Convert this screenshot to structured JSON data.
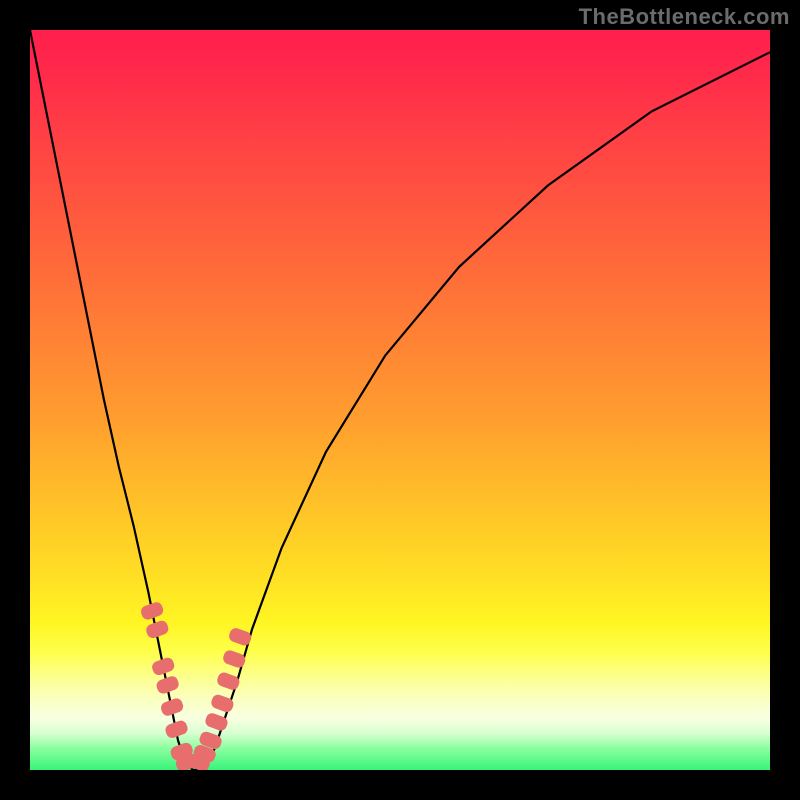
{
  "watermark": {
    "text": "TheBottleneck.com"
  },
  "chart_data": {
    "type": "line",
    "title": "",
    "xlabel": "",
    "ylabel": "",
    "xlim": [
      0,
      100
    ],
    "ylim": [
      0,
      100
    ],
    "grid": false,
    "legend": false,
    "series": [
      {
        "name": "bottleneck-curve",
        "x": [
          0,
          2,
          4,
          6,
          8,
          10,
          12,
          14,
          16,
          18,
          19,
          20,
          21,
          22,
          23,
          24,
          25,
          26,
          28,
          30,
          34,
          40,
          48,
          58,
          70,
          84,
          100
        ],
        "values": [
          100,
          90,
          80,
          70,
          60,
          50,
          41,
          33,
          24,
          14,
          9,
          4,
          1,
          0,
          0,
          1,
          3,
          6,
          12,
          19,
          30,
          43,
          56,
          68,
          79,
          89,
          97
        ]
      },
      {
        "name": "highlight-points-left",
        "x": [
          16.5,
          17.2,
          18.0,
          18.6,
          19.2,
          19.8,
          20.5,
          21.2
        ],
        "values": [
          21.5,
          19.0,
          14.0,
          11.5,
          8.5,
          5.5,
          2.5,
          1.0
        ]
      },
      {
        "name": "highlight-points-right",
        "x": [
          22.8,
          23.6,
          24.4,
          25.2,
          26.0,
          26.8,
          27.6,
          28.4
        ],
        "values": [
          1.0,
          2.2,
          4.0,
          6.5,
          9.0,
          12.0,
          15.0,
          18.0
        ]
      }
    ],
    "background_gradient": {
      "orientation": "vertical",
      "stops": [
        {
          "pos": 0.0,
          "color": "#ff1f4d"
        },
        {
          "pos": 0.5,
          "color": "#ffaa2d"
        },
        {
          "pos": 0.8,
          "color": "#fff523"
        },
        {
          "pos": 0.93,
          "color": "#f8ffe0"
        },
        {
          "pos": 1.0,
          "color": "#38f47a"
        }
      ]
    },
    "marker_color": "#e86d6d",
    "curve_color": "#000000"
  }
}
